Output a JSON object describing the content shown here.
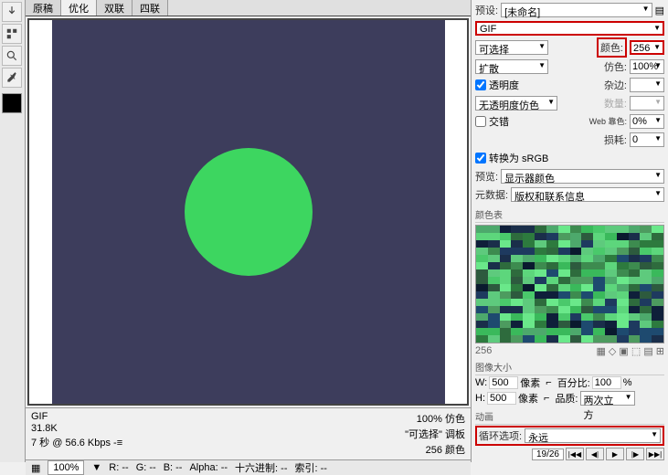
{
  "tabs": [
    "原稿",
    "优化",
    "双联",
    "四联"
  ],
  "active_tab": 1,
  "status": {
    "format": "GIF",
    "size": "31.8K",
    "time": "7 秒 @ 56.6 Kbps  -≡",
    "dither_right": "100% 仿色",
    "palette_right": "\"可选择\" 调板",
    "colors_right": "256 颜色"
  },
  "bottom": {
    "zoom": "100%",
    "r": "R: --",
    "g": "G: --",
    "b": "B: --",
    "alpha": "Alpha: --",
    "hex": "十六进制: --",
    "index": "索引: --"
  },
  "right": {
    "preset_label": "预设:",
    "preset_value": "[未命名]",
    "format": "GIF",
    "algo_label": "可选择",
    "colors_label": "颜色:",
    "colors_value": "256",
    "diffuse_label": "扩散",
    "dither_label": "仿色:",
    "dither_value": "100%",
    "transparency_label": "透明度",
    "matte_label": "杂边:",
    "trans_dither_label": "无透明度仿色",
    "amount_label": "数量:",
    "interlace_label": "交错",
    "web_label": "Web 靠色:",
    "web_value": "0%",
    "lossy_label": "损耗:",
    "lossy_value": "0",
    "convert_srgb": "转换为 sRGB",
    "preview_label": "预览:",
    "preview_value": "显示器颜色",
    "metadata_label": "元数据:",
    "metadata_value": "版权和联系信息",
    "color_table_title": "颜色表",
    "color_table_count": "256",
    "image_size_title": "图像大小",
    "w_label": "W:",
    "w_value": "500",
    "h_label": "H:",
    "h_value": "500",
    "px": "像素",
    "percent_label": "百分比:",
    "percent_value": "100",
    "percent_suffix": "%",
    "quality_label": "品质:",
    "quality_value": "两次立方",
    "anim_title": "动画",
    "loop_label": "循环选项:",
    "loop_value": "永远",
    "frame": "19/26"
  },
  "color_table_colors": [
    "#1e3a5f",
    "#2d7a3e",
    "#4ac96b",
    "#1a2e4a",
    "#3d8b4f",
    "#5dd67c",
    "#0f1f3a",
    "#2e6b3d",
    "#6ae88a",
    "#1e4a6f",
    "#4d9b5f",
    "#3ab95b",
    "#0a1a2e",
    "#5eca7d",
    "#2d5a3e",
    "#4da96c"
  ]
}
